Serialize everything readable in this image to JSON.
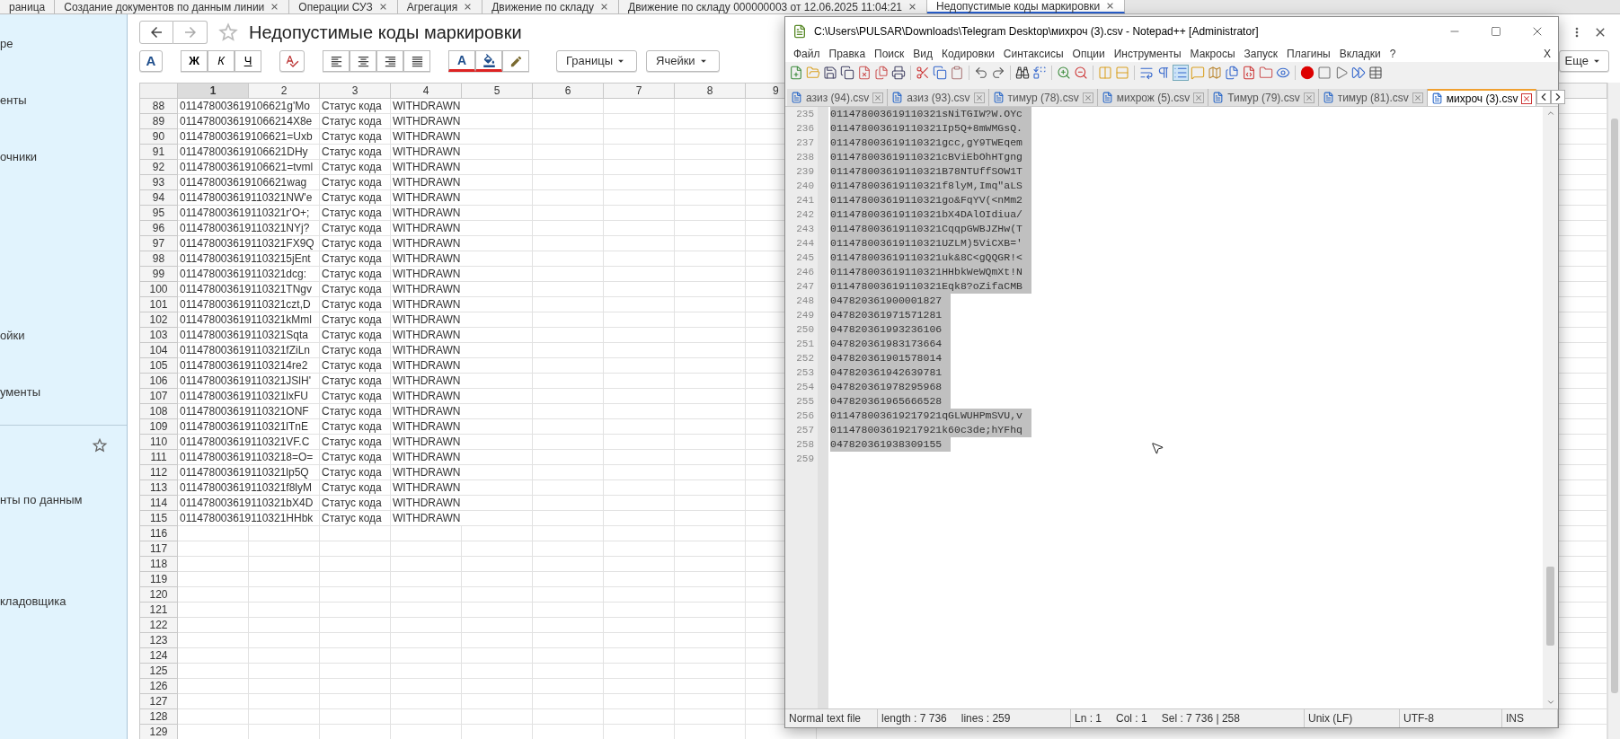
{
  "tabs": [
    {
      "label": "раница",
      "selected": false,
      "closable": false
    },
    {
      "label": "Создание документов по данным линии",
      "selected": false,
      "closable": true
    },
    {
      "label": "Операции СУЗ",
      "selected": false,
      "closable": true
    },
    {
      "label": "Агрегация",
      "selected": false,
      "closable": true
    },
    {
      "label": "Движение по складу",
      "selected": false,
      "closable": true
    },
    {
      "label": "Движение по складу 000000003 от 12.06.2025 11:04:21",
      "selected": false,
      "closable": true
    },
    {
      "label": "Недопустимые коды маркировки",
      "selected": true,
      "closable": true
    }
  ],
  "sidebar": {
    "items": [
      {
        "label": "ре"
      },
      {
        "label": "енты"
      },
      {
        "label": "очники"
      },
      {
        "label": "ойки"
      },
      {
        "label": "ументы"
      }
    ],
    "favorites_items": [
      {
        "label": "нты по данным"
      },
      {
        "label": "кладовщика"
      }
    ]
  },
  "document": {
    "title": "Недопустимые коды маркировки",
    "toolbar": {
      "font_button": "A",
      "format_buttons": [
        "Ж",
        "К",
        "Ч"
      ],
      "text_color_button": "A",
      "dropdowns": [
        "Границы",
        "Ячейки"
      ],
      "more_button": "Еще"
    },
    "grid": {
      "columns": [
        {
          "label": "1",
          "selected": true
        },
        {
          "label": "2",
          "selected": false
        },
        {
          "label": "3",
          "selected": false
        },
        {
          "label": "4",
          "selected": false
        },
        {
          "label": "5",
          "selected": false
        },
        {
          "label": "6",
          "selected": false
        },
        {
          "label": "7",
          "selected": false
        },
        {
          "label": "8",
          "selected": false
        },
        {
          "label": "9",
          "selected": false
        }
      ],
      "rows": [
        {
          "number": "88",
          "column_1": "011478003619106621g'Mo",
          "column_3": "Статус кода",
          "column_4": "WITHDRAWN"
        },
        {
          "number": "89",
          "column_1": "0114780036191066214X8e",
          "column_3": "Статус кода",
          "column_4": "WITHDRAWN"
        },
        {
          "number": "90",
          "column_1": "011478003619106621=Uxb",
          "column_3": "Статус кода",
          "column_4": "WITHDRAWN"
        },
        {
          "number": "91",
          "column_1": "011478003619106621DHy",
          "column_3": "Статус кода",
          "column_4": "WITHDRAWN"
        },
        {
          "number": "92",
          "column_1": "011478003619106621=tvml",
          "column_3": "Статус кода",
          "column_4": "WITHDRAWN"
        },
        {
          "number": "93",
          "column_1": "011478003619106621wag",
          "column_3": "Статус кода",
          "column_4": "WITHDRAWN"
        },
        {
          "number": "94",
          "column_1": "011478003619110321NW'e",
          "column_3": "Статус кода",
          "column_4": "WITHDRAWN"
        },
        {
          "number": "95",
          "column_1": "011478003619110321r'O+;",
          "column_3": "Статус кода",
          "column_4": "WITHDRAWN"
        },
        {
          "number": "96",
          "column_1": "011478003619110321NYj?",
          "column_3": "Статус кода",
          "column_4": "WITHDRAWN"
        },
        {
          "number": "97",
          "column_1": "011478003619110321FX9Q",
          "column_3": "Статус кода",
          "column_4": "WITHDRAWN"
        },
        {
          "number": "98",
          "column_1": "0114780036191103215jEnt",
          "column_3": "Статус кода",
          "column_4": "WITHDRAWN"
        },
        {
          "number": "99",
          "column_1": "011478003619110321dcg:",
          "column_3": "Статус кода",
          "column_4": "WITHDRAWN"
        },
        {
          "number": "100",
          "column_1": "011478003619110321TNgv",
          "column_3": "Статус кода",
          "column_4": "WITHDRAWN"
        },
        {
          "number": "101",
          "column_1": "011478003619110321czt,D",
          "column_3": "Статус кода",
          "column_4": "WITHDRAWN"
        },
        {
          "number": "102",
          "column_1": "011478003619110321kMml",
          "column_3": "Статус кода",
          "column_4": "WITHDRAWN"
        },
        {
          "number": "103",
          "column_1": "011478003619110321Sqta",
          "column_3": "Статус кода",
          "column_4": "WITHDRAWN"
        },
        {
          "number": "104",
          "column_1": "011478003619110321fZiLn",
          "column_3": "Статус кода",
          "column_4": "WITHDRAWN"
        },
        {
          "number": "105",
          "column_1": "0114780036191103214re2",
          "column_3": "Статус кода",
          "column_4": "WITHDRAWN"
        },
        {
          "number": "106",
          "column_1": "011478003619110321JSlH'",
          "column_3": "Статус кода",
          "column_4": "WITHDRAWN"
        },
        {
          "number": "107",
          "column_1": "011478003619110321lxFU",
          "column_3": "Статус кода",
          "column_4": "WITHDRAWN"
        },
        {
          "number": "108",
          "column_1": "011478003619110321ONF",
          "column_3": "Статус кода",
          "column_4": "WITHDRAWN"
        },
        {
          "number": "109",
          "column_1": "011478003619110321lTnE",
          "column_3": "Статус кода",
          "column_4": "WITHDRAWN"
        },
        {
          "number": "110",
          "column_1": "011478003619110321VF.C",
          "column_3": "Статус кода",
          "column_4": "WITHDRAWN"
        },
        {
          "number": "111",
          "column_1": "0114780036191103218=O=",
          "column_3": "Статус кода",
          "column_4": "WITHDRAWN"
        },
        {
          "number": "112",
          "column_1": "011478003619110321lp5Q",
          "column_3": "Статус кода",
          "column_4": "WITHDRAWN"
        },
        {
          "number": "113",
          "column_1": "011478003619110321f8lyM",
          "column_3": "Статус кода",
          "column_4": "WITHDRAWN"
        },
        {
          "number": "114",
          "column_1": "011478003619110321bX4D",
          "column_3": "Статус кода",
          "column_4": "WITHDRAWN"
        },
        {
          "number": "115",
          "column_1": "011478003619110321HHbk",
          "column_3": "Статус кода",
          "column_4": "WITHDRAWN"
        },
        {
          "number": "116"
        },
        {
          "number": "117"
        },
        {
          "number": "118"
        },
        {
          "number": "119"
        },
        {
          "number": "120"
        },
        {
          "number": "121"
        },
        {
          "number": "122"
        },
        {
          "number": "123"
        },
        {
          "number": "124"
        },
        {
          "number": "125"
        },
        {
          "number": "126"
        },
        {
          "number": "127"
        },
        {
          "number": "128"
        },
        {
          "number": "129"
        }
      ]
    }
  },
  "notepad": {
    "title": "C:\\Users\\PULSAR\\Downloads\\Telegram Desktop\\михроч (3).csv - Notepad++ [Administrator]",
    "menu": [
      "Файл",
      "Правка",
      "Поиск",
      "Вид",
      "Кодировки",
      "Синтаксисы",
      "Опции",
      "Инструменты",
      "Макросы",
      "Запуск",
      "Плагины",
      "Вкладки",
      "?"
    ],
    "menu_close": "X",
    "tabs": [
      {
        "label": "азиз (94).csv",
        "selected": false
      },
      {
        "label": "азиз (93).csv",
        "selected": false
      },
      {
        "label": "тимур (78).csv",
        "selected": false
      },
      {
        "label": "михрож (5).csv",
        "selected": false
      },
      {
        "label": "Тимур (79).csv",
        "selected": false
      },
      {
        "label": "тимур (81).csv",
        "selected": false
      },
      {
        "label": "михроч (3).csv",
        "selected": true
      }
    ],
    "lines": [
      {
        "number": "235",
        "text": "011478003619110321sNiTGIW?W.OYc",
        "selected": true
      },
      {
        "number": "236",
        "text": "011478003619110321Ip5Q+8mWMGsQ.",
        "selected": true
      },
      {
        "number": "237",
        "text": "011478003619110321gcc,gY9TWEqem",
        "selected": true
      },
      {
        "number": "238",
        "text": "011478003619110321cBViEbOhHTgng",
        "selected": true
      },
      {
        "number": "239",
        "text": "011478003619110321B78NTUffSOW1T",
        "selected": true
      },
      {
        "number": "240",
        "text": "011478003619110321f8lyM,Imq\"aLS",
        "selected": true
      },
      {
        "number": "241",
        "text": "011478003619110321go&FqYV(<nMm2",
        "selected": true
      },
      {
        "number": "242",
        "text": "011478003619110321bX4DAlOIdiua/",
        "selected": true
      },
      {
        "number": "243",
        "text": "011478003619110321CqqpGWBJZHw(T",
        "selected": true
      },
      {
        "number": "244",
        "text": "011478003619110321UZLM)5ViCXB='",
        "selected": true
      },
      {
        "number": "245",
        "text": "011478003619110321uk&8C<gQQGR!<",
        "selected": true
      },
      {
        "number": "246",
        "text": "011478003619110321HHbkWeWQmXt!N",
        "selected": true
      },
      {
        "number": "247",
        "text": "011478003619110321Eqk8?oZifaCMB",
        "selected": true
      },
      {
        "number": "248",
        "text": "047820361900001827",
        "selected": true
      },
      {
        "number": "249",
        "text": "047820361971571281",
        "selected": true
      },
      {
        "number": "250",
        "text": "047820361993236106",
        "selected": true
      },
      {
        "number": "251",
        "text": "047820361983173664",
        "selected": true
      },
      {
        "number": "252",
        "text": "047820361901578014",
        "selected": true
      },
      {
        "number": "253",
        "text": "047820361942639781",
        "selected": true
      },
      {
        "number": "254",
        "text": "047820361978295968",
        "selected": true
      },
      {
        "number": "255",
        "text": "047820361965666528",
        "selected": true
      },
      {
        "number": "256",
        "text": "011478003619217921qGLWUHPmSVU,v",
        "selected": true
      },
      {
        "number": "257",
        "text": "011478003619217921k60c3de;hYFhq",
        "selected": true
      },
      {
        "number": "258",
        "text": "047820361938309155",
        "selected": true
      },
      {
        "number": "259"
      }
    ],
    "status_bar": [
      {
        "items": [
          "Normal text file"
        ]
      },
      {
        "items": [
          "length : 7 736",
          "lines : 259"
        ]
      },
      {
        "items": [
          "Ln : 1",
          "Col : 1",
          "Sel : 7 736 | 258"
        ]
      },
      {
        "items": [
          "Unix (LF)"
        ]
      },
      {
        "items": [
          "UTF-8"
        ]
      },
      {
        "items": [
          "INS"
        ]
      }
    ]
  }
}
